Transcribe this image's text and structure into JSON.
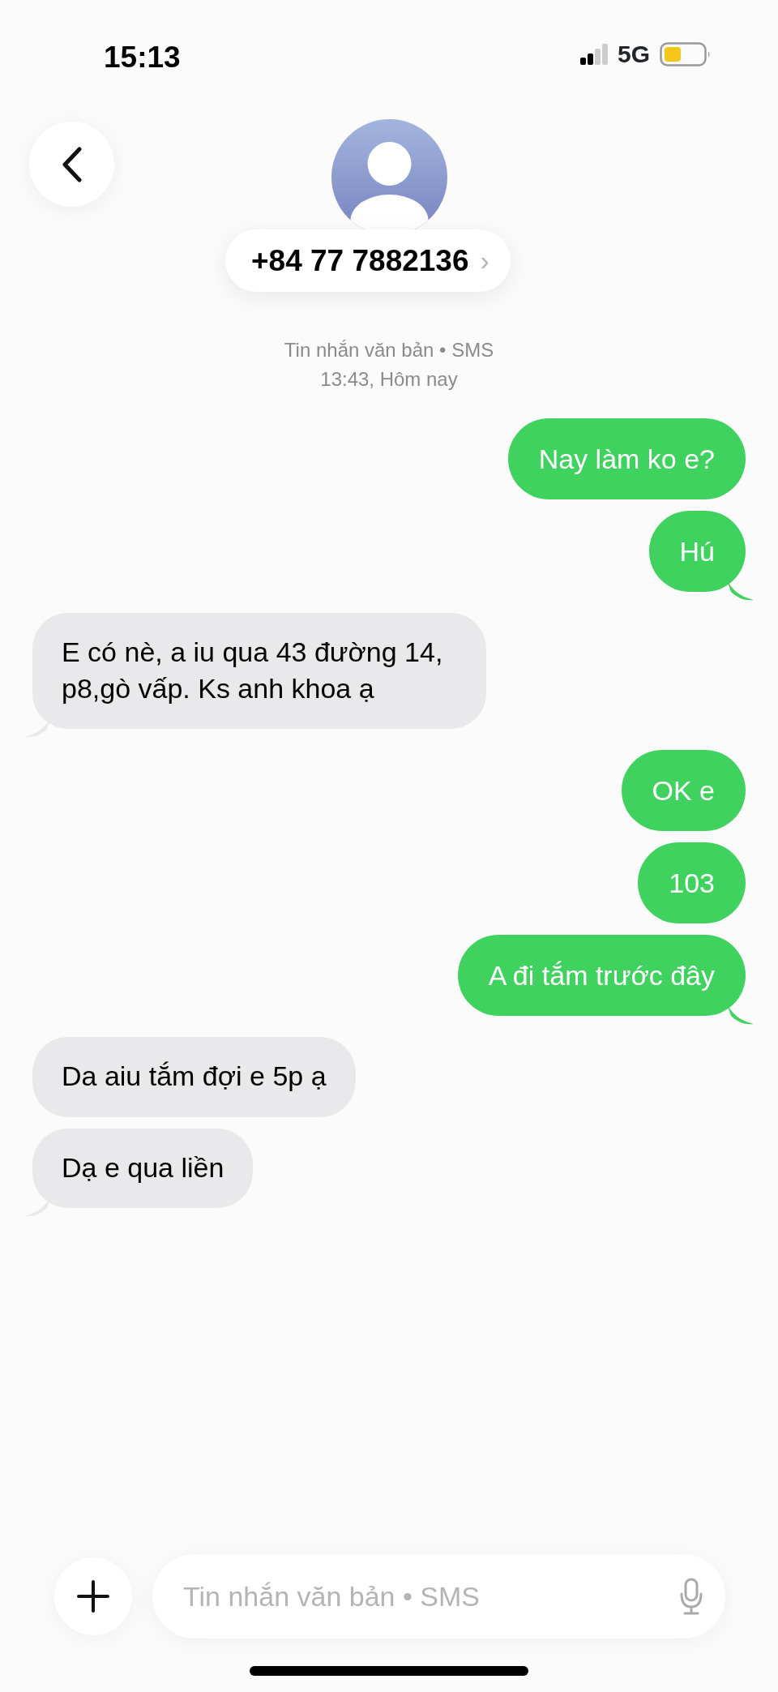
{
  "status_bar": {
    "time": "15:13",
    "network": "5G"
  },
  "contact": {
    "phone": "+84 77 7882136",
    "chevron": "›"
  },
  "thread_info": {
    "service": "Tin nhắn văn bản • SMS",
    "timestamp": "13:43, Hôm nay"
  },
  "messages": [
    {
      "kind": "outgoing",
      "text": "Nay làm ko e?",
      "tail": false
    },
    {
      "kind": "outgoing",
      "text": "Hú",
      "tail": true
    },
    {
      "kind": "incoming",
      "text": "E có nè, a iu qua 43 đường 14, p8,gò vấp. Ks anh khoa ạ",
      "tail": true
    },
    {
      "kind": "outgoing",
      "text": "OK e",
      "tail": false
    },
    {
      "kind": "outgoing",
      "text": "103",
      "tail": false
    },
    {
      "kind": "outgoing",
      "text": "A đi tắm trước đây",
      "tail": true
    },
    {
      "kind": "incoming",
      "text": "Da aiu tắm đợi e 5p ạ",
      "tail": false
    },
    {
      "kind": "incoming",
      "text": "Dạ e qua liền",
      "tail": true
    }
  ],
  "composer": {
    "placeholder": "Tin nhắn văn bản • SMS"
  }
}
